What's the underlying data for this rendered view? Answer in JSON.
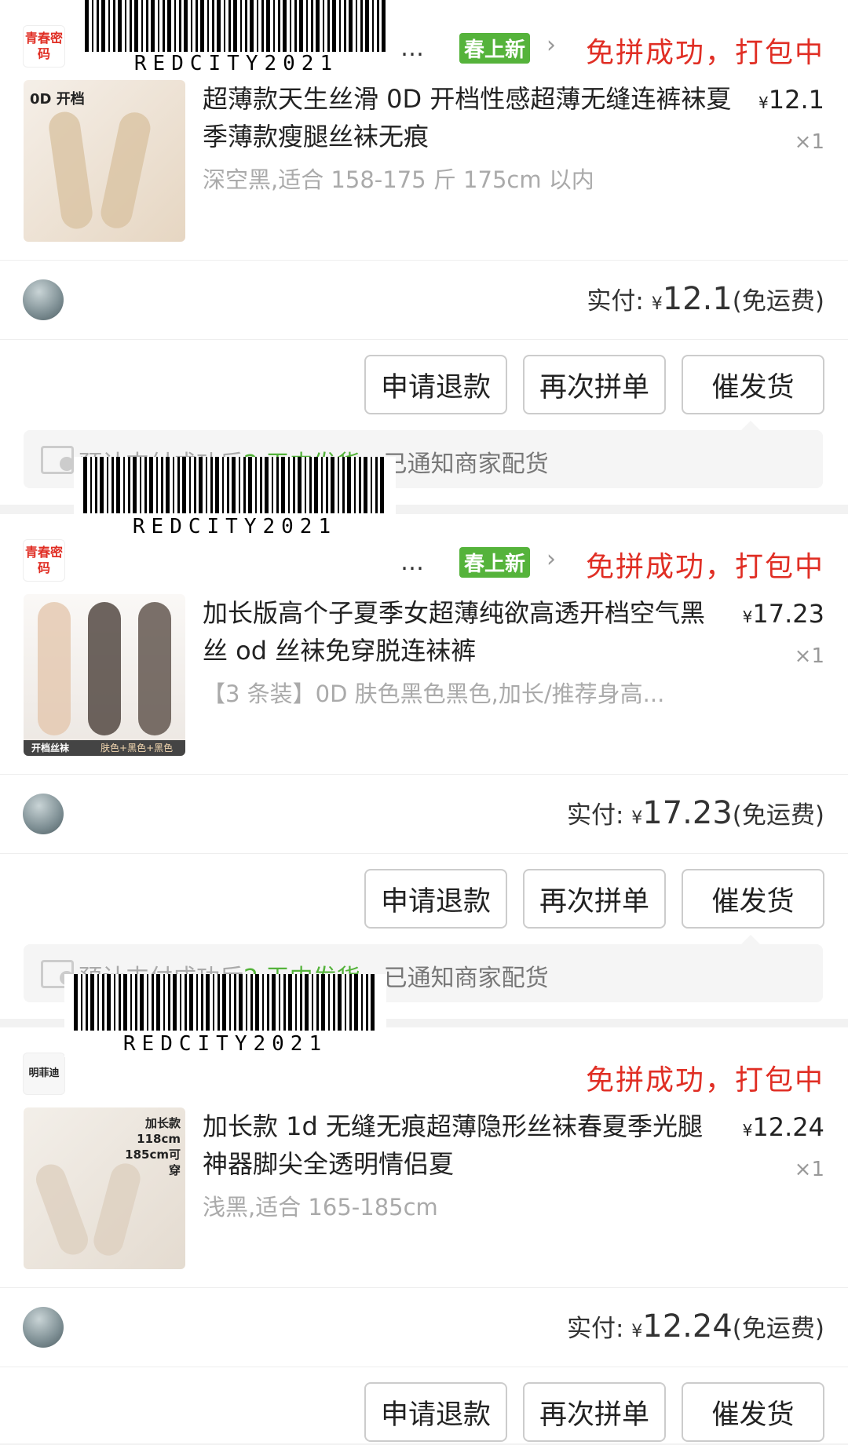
{
  "orders": [
    {
      "shop_logo": "青春密码",
      "barcode": "REDCITY2021",
      "ellipsis": "…",
      "tag": "春上新",
      "status": "免拼成功，打包中",
      "product": {
        "image_label": "0D 开档",
        "title": "超薄款天生丝滑 0D 开档性感超薄无缝连裤袜夏季薄款瘦腿丝袜无痕",
        "currency": "¥",
        "price": "12.1",
        "qty": "×1",
        "spec": "深空黑,适合 158-175 斤 175cm 以内"
      },
      "pay_label": "实付:",
      "pay_currency": "¥",
      "pay_amount": "12.1",
      "pay_note": "(免运费)",
      "buttons": [
        "申请退款",
        "再次拼单",
        "催发货"
      ],
      "notice_pre": "预计支付成功后",
      "notice_green": "2 天内发货",
      "notice_post": "，已通知商家配货"
    },
    {
      "shop_logo": "青春密码",
      "barcode": "REDCITY2021",
      "ellipsis": "…",
      "tag": "春上新",
      "status": "免拼成功，打包中",
      "product": {
        "image_label": "开档丝袜",
        "image_sub": "肤色+黑色+黑色",
        "title": "加长版高个子夏季女超薄纯欲高透开档空气黑丝 od 丝袜免穿脱连袜裤",
        "currency": "¥",
        "price": "17.23",
        "qty": "×1",
        "spec": "【3 条装】0D 肤色黑色黑色,加长/推荐身高..."
      },
      "pay_label": "实付:",
      "pay_currency": "¥",
      "pay_amount": "17.23",
      "pay_note": "(免运费)",
      "buttons": [
        "申请退款",
        "再次拼单",
        "催发货"
      ],
      "notice_pre": "预计支付成功后",
      "notice_green": "2 天内发货",
      "notice_post": "，已通知商家配货"
    },
    {
      "shop_logo": "明菲迪",
      "barcode": "REDCITY2021",
      "status": "免拼成功，打包中",
      "product": {
        "image_label": "加长款 118cm 185cm可穿",
        "title": "加长款 1d 无缝无痕超薄隐形丝袜春夏季光腿神器脚尖全透明情侣夏",
        "currency": "¥",
        "price": "12.24",
        "qty": "×1",
        "spec": "浅黑,适合 165-185cm"
      },
      "pay_label": "实付:",
      "pay_currency": "¥",
      "pay_amount": "12.24",
      "pay_note": "(免运费)",
      "buttons": [
        "申请退款",
        "再次拼单",
        "催发货"
      ]
    }
  ]
}
